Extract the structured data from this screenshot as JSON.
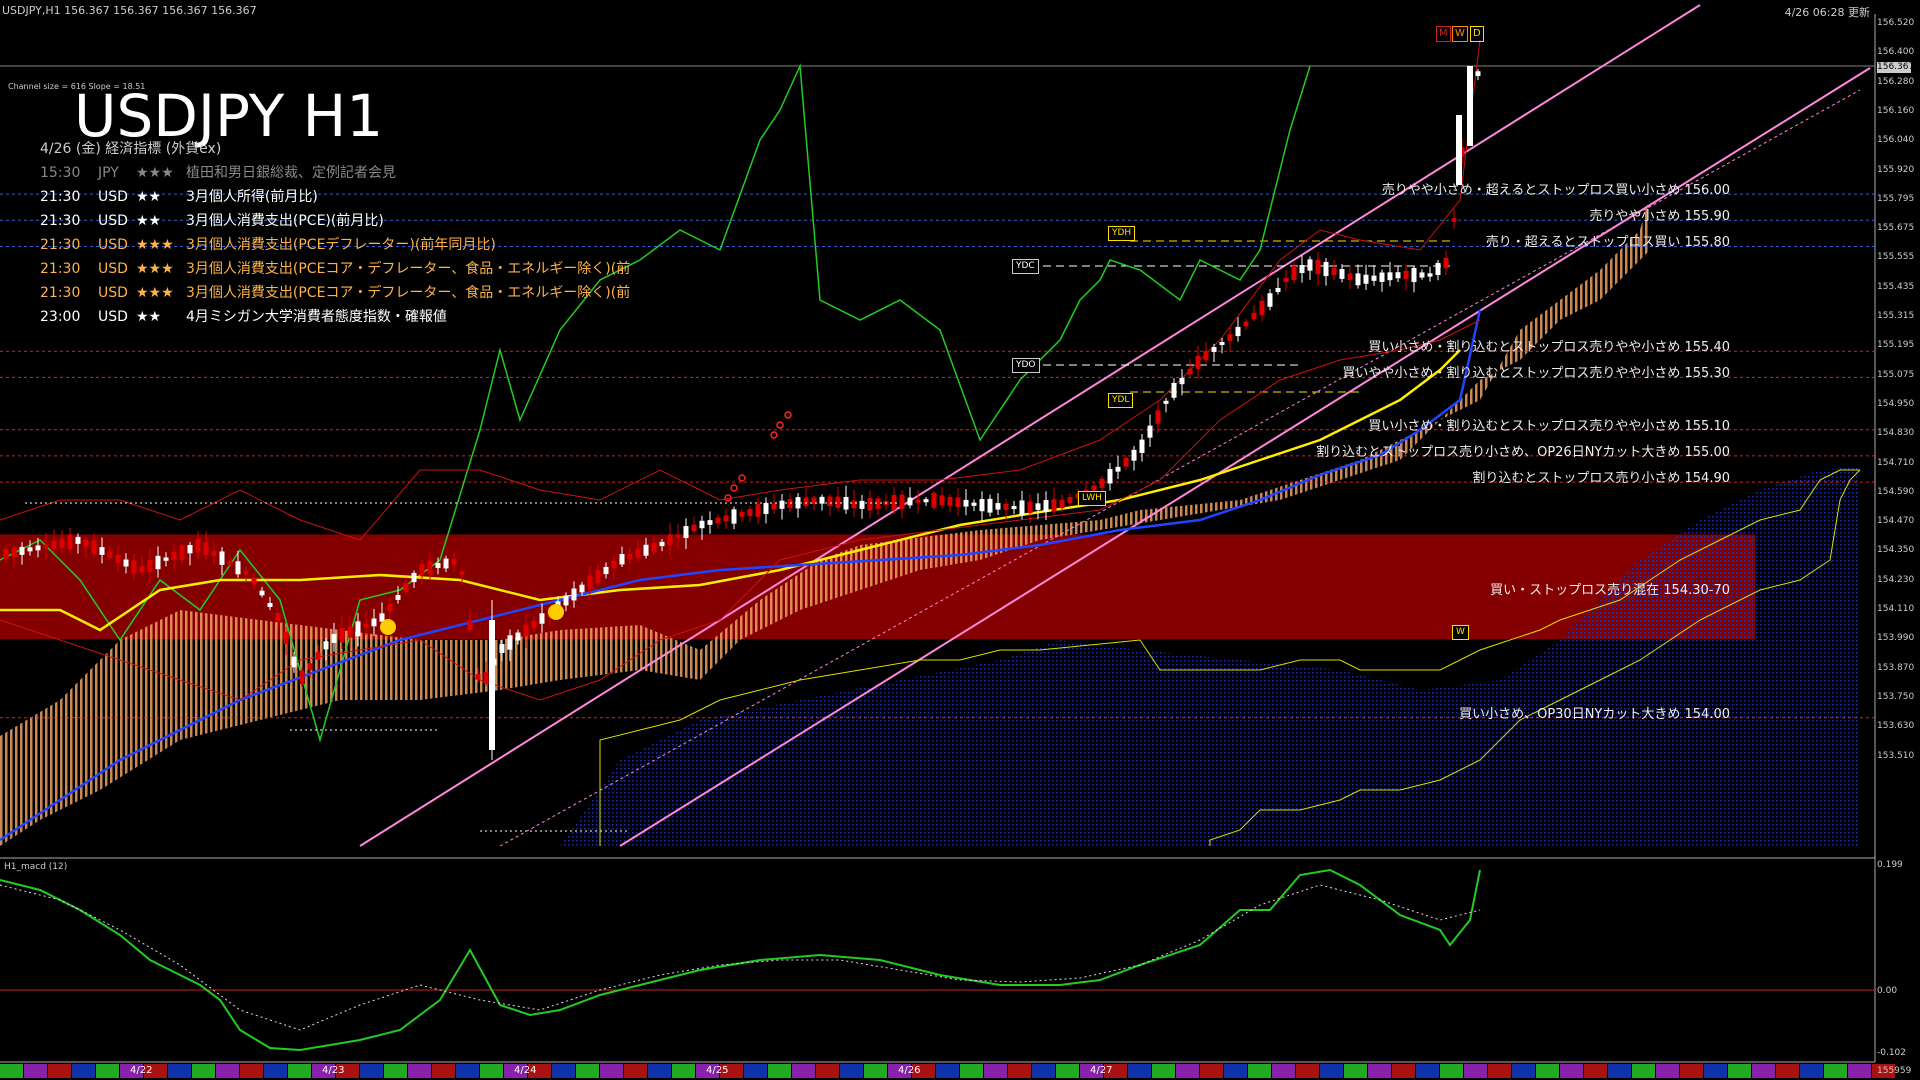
{
  "header": {
    "symbol_info": "USDJPY,H1  156.367 156.367 156.367 156.367",
    "update_time": "4/26 06:28 更新"
  },
  "channel_info": "Channel size = 616 Slope = 18.51",
  "title": "USDJPY H1",
  "economic": {
    "heading": "4/26 (金) 経済指標 (外貨ex)",
    "items": [
      {
        "time": "15:30",
        "ccy": "JPY",
        "stars": "★★★",
        "event": "植田和男日銀総裁、定例記者会見",
        "color": "#888888"
      },
      {
        "time": "21:30",
        "ccy": "USD",
        "stars": "★★",
        "event": "3月個人所得(前月比)",
        "color": "#ffffff"
      },
      {
        "time": "21:30",
        "ccy": "USD",
        "stars": "★★",
        "event": "3月個人消費支出(PCE)(前月比)",
        "color": "#ffffff"
      },
      {
        "time": "21:30",
        "ccy": "USD",
        "stars": "★★★",
        "event": "3月個人消費支出(PCEデフレーター)(前年同月比)",
        "color": "#ffb347"
      },
      {
        "time": "21:30",
        "ccy": "USD",
        "stars": "★★★",
        "event": "3月個人消費支出(PCEコア・デフレーター、食品・エネルギー除く)(前",
        "color": "#ffb347"
      },
      {
        "time": "21:30",
        "ccy": "USD",
        "stars": "★★★",
        "event": "3月個人消費支出(PCEコア・デフレーター、食品・エネルギー除く)(前",
        "color": "#ffb347"
      },
      {
        "time": "23:00",
        "ccy": "USD",
        "stars": "★★",
        "event": "4月ミシガン大学消費者態度指数・確報値",
        "color": "#ffffff"
      }
    ]
  },
  "levels": [
    {
      "price": 156.0,
      "text": "売りやや小さめ・超えるとストップロス買い小さめ 156.00",
      "line": "#4477ff"
    },
    {
      "price": 155.9,
      "text": "売りやや小さめ 155.90",
      "line": "#4477ff"
    },
    {
      "price": 155.8,
      "text": "売り・超えるとストップロス買い 155.80",
      "line": "#4477ff"
    },
    {
      "price": 155.4,
      "text": "買い小さめ・割り込むとストップロス売りやや小さめ 155.40",
      "line": "#ff3333"
    },
    {
      "price": 155.3,
      "text": "買いやや小さめ・割り込むとストップロス売りやや小さめ 155.30",
      "line": "#ff3333"
    },
    {
      "price": 155.1,
      "text": "買い小さめ・割り込むとストップロス売りやや小さめ 155.10",
      "line": "#ff3333"
    },
    {
      "price": 155.0,
      "text": "割り込むとストップロス売り小さめ、OP26日NYカット大きめ 155.00",
      "line": "#ff3333"
    },
    {
      "price": 154.9,
      "text": "割り込むとストップロス売り小さめ 154.90",
      "line": "#ff3333"
    },
    {
      "price": 154.0,
      "text": "買い小さめ、OP30日NYカット大きめ 154.00",
      "line": "#ff3333"
    }
  ],
  "zone": {
    "low": 154.3,
    "high": 154.7,
    "text": "買い・ストップロス売り混在 154.30-70"
  },
  "markers": {
    "ydh": "YDH",
    "ydc": "YDC",
    "ydo": "YDO",
    "ydl": "YDL",
    "lwh": "LWH",
    "w": "W"
  },
  "mwd": [
    "M",
    "W",
    "D"
  ],
  "price_axis": [
    "156.520",
    "156.400",
    "156.280",
    "156.160",
    "156.040",
    "155.920",
    "155.795",
    "155.675",
    "155.555",
    "155.435",
    "155.315",
    "155.195",
    "155.075",
    "154.950",
    "154.830",
    "154.710",
    "154.590",
    "154.470",
    "154.350",
    "154.230",
    "154.110",
    "153.990",
    "153.870",
    "153.750",
    "153.630",
    "153.510"
  ],
  "current_price": "156.367",
  "macd": {
    "name": "H1_macd (12)",
    "axis": [
      "0.199",
      "0.00",
      "-0.102"
    ]
  },
  "dates": [
    "4/22",
    "4/23",
    "4/24",
    "4/25",
    "4/26",
    "4/27"
  ],
  "bottom_right": "155959",
  "colors": {
    "bg": "#000000",
    "candle_up": "#ffffff",
    "candle_down": "#dd0000",
    "zone": "#8b0000",
    "channel": "#ff88dd",
    "sma_yellow": "#ffee00",
    "sma_blue": "#2244ff",
    "span_green": "#22cc22"
  }
}
